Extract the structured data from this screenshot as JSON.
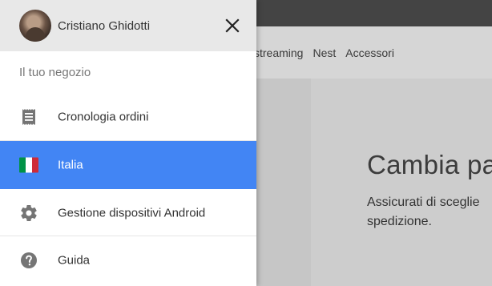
{
  "background_page": {
    "nav_links": [
      "i streaming",
      "Nest",
      "Accessori"
    ],
    "heading": "Cambia pa",
    "text_lines": [
      "Assicurati di sceglie",
      "spedizione."
    ]
  },
  "drawer": {
    "user": {
      "name": "Cristiano Ghidotti",
      "avatar_icon": "avatar-photo"
    },
    "close_icon": "close-icon",
    "section_title": "Il tuo negozio",
    "items": [
      {
        "label": "Cronologia ordini",
        "icon": "receipt-icon",
        "active": false
      },
      {
        "label": "Italia",
        "icon": "italy-flag-icon",
        "active": true
      },
      {
        "label": "Gestione dispositivi Android",
        "icon": "gear-icon",
        "active": false
      },
      {
        "label": "Guida",
        "icon": "help-icon",
        "active": false
      }
    ],
    "colors": {
      "active_bg": "#4285f4",
      "header_bg": "#e8e8e8",
      "flag": [
        "#009246",
        "#ffffff",
        "#ce2b37"
      ]
    }
  }
}
